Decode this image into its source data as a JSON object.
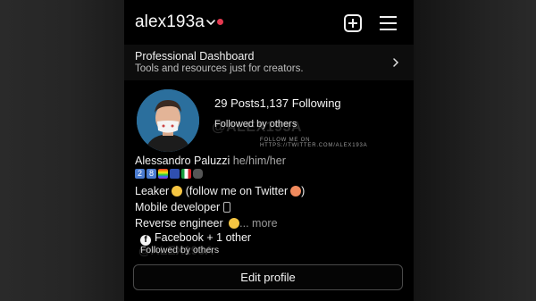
{
  "profile": {
    "username": "alex193a",
    "display_name": "Alessandro Paluzzi",
    "pronouns": "he/him/her",
    "posts_label": "29 Posts",
    "following_label": "1,137 Following",
    "followed_by": "Followed by others"
  },
  "header": {
    "chevron_icon": "chevron-down-icon",
    "notification_dot_color": "#e53950",
    "create_icon": "plus-square-icon",
    "menu_icon": "hamburger-menu-icon"
  },
  "dashboard": {
    "title": "Professional Dashboard",
    "subtitle": "Tools and resources just for creators.",
    "arrow_icon": "chevron-right-icon"
  },
  "watermark": {
    "handle": "@ALEX193A",
    "follow_text": "FOLLOW ME ON HTTPS://TWITTER.COM/ALEX193A"
  },
  "bio": {
    "line1": "Leaker",
    "line1_rest": "(follow me on Twitter",
    "line1_end": ")",
    "line2": "Mobile developer",
    "line3": "Reverse engineer",
    "more": "... more"
  },
  "links": {
    "facebook": "Facebook + 1 other",
    "followed_by": "Followed by others"
  },
  "actions": {
    "edit_profile": "Edit profile"
  }
}
